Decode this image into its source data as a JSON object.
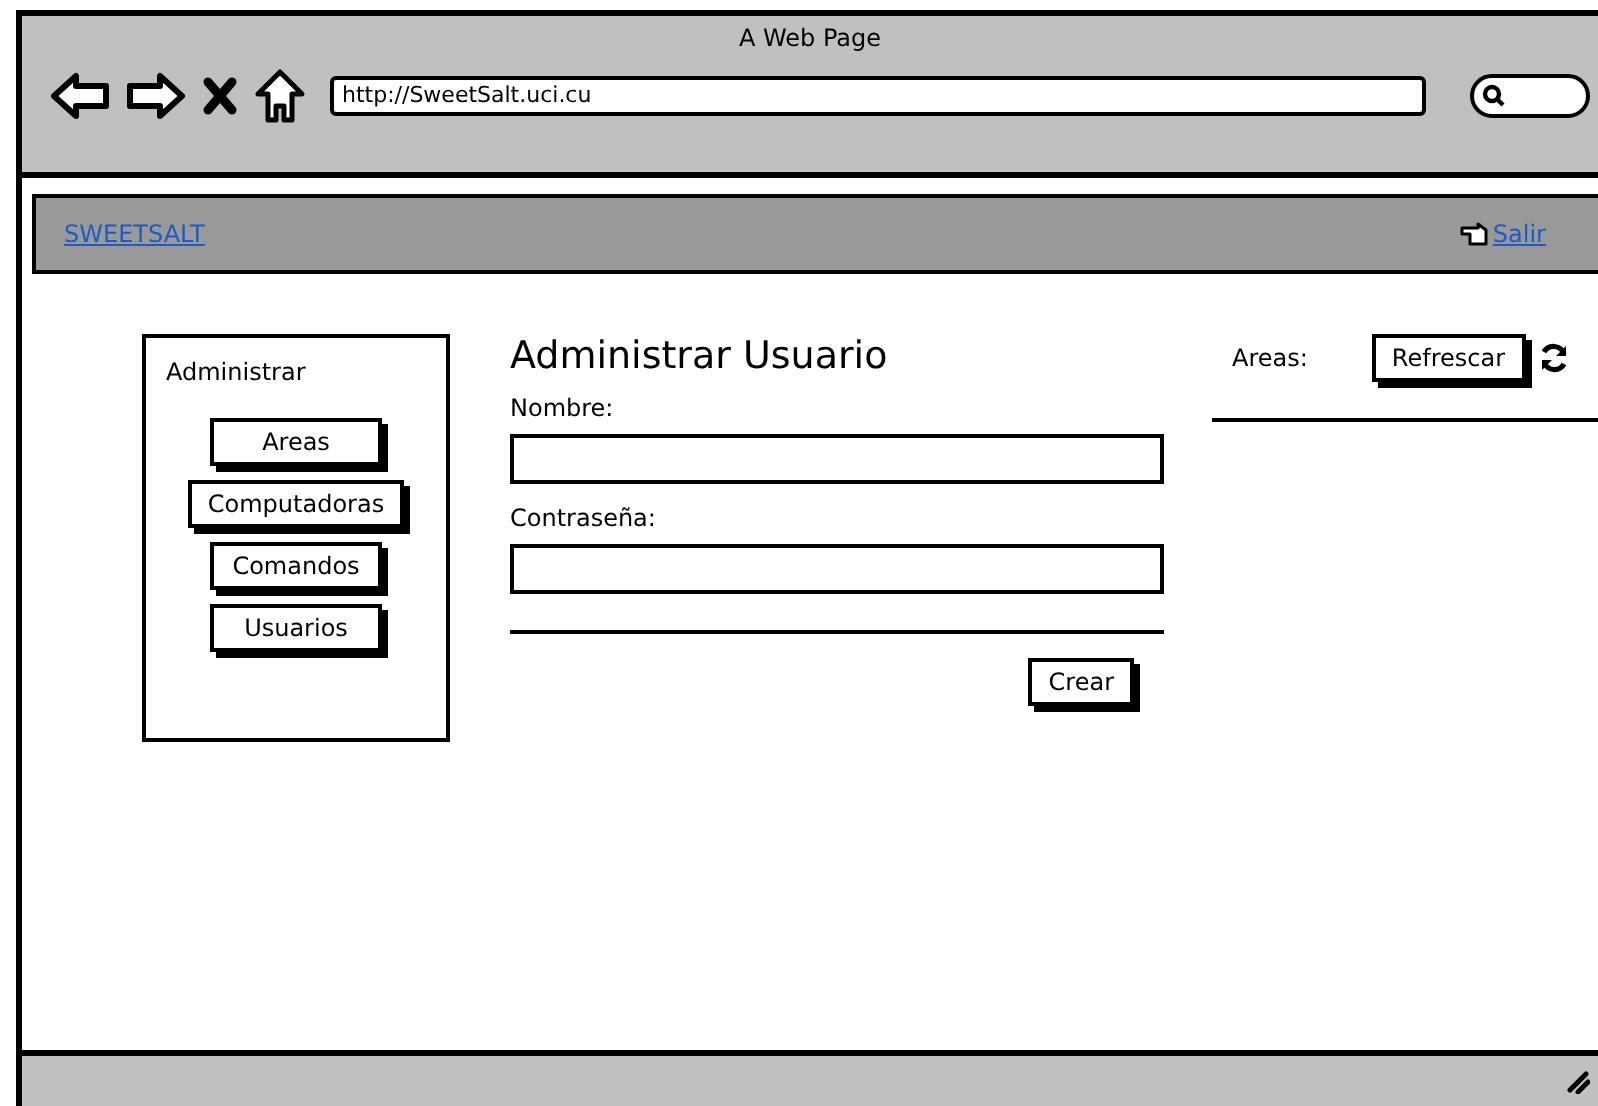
{
  "window": {
    "title": "A Web Page",
    "url": "http://SweetSalt.uci.cu"
  },
  "navbar": {
    "brand": "SWEETSALT",
    "logout": "Salir"
  },
  "sidebar": {
    "title": "Administrar",
    "items": [
      "Areas",
      "Computadoras",
      "Comandos",
      "Usuarios"
    ]
  },
  "form": {
    "title": "Administrar Usuario",
    "fields": [
      {
        "label": "Nombre:"
      },
      {
        "label": "Contraseña:"
      }
    ],
    "submit": "Crear"
  },
  "areas": {
    "label": "Areas:",
    "refresh": "Refrescar"
  }
}
